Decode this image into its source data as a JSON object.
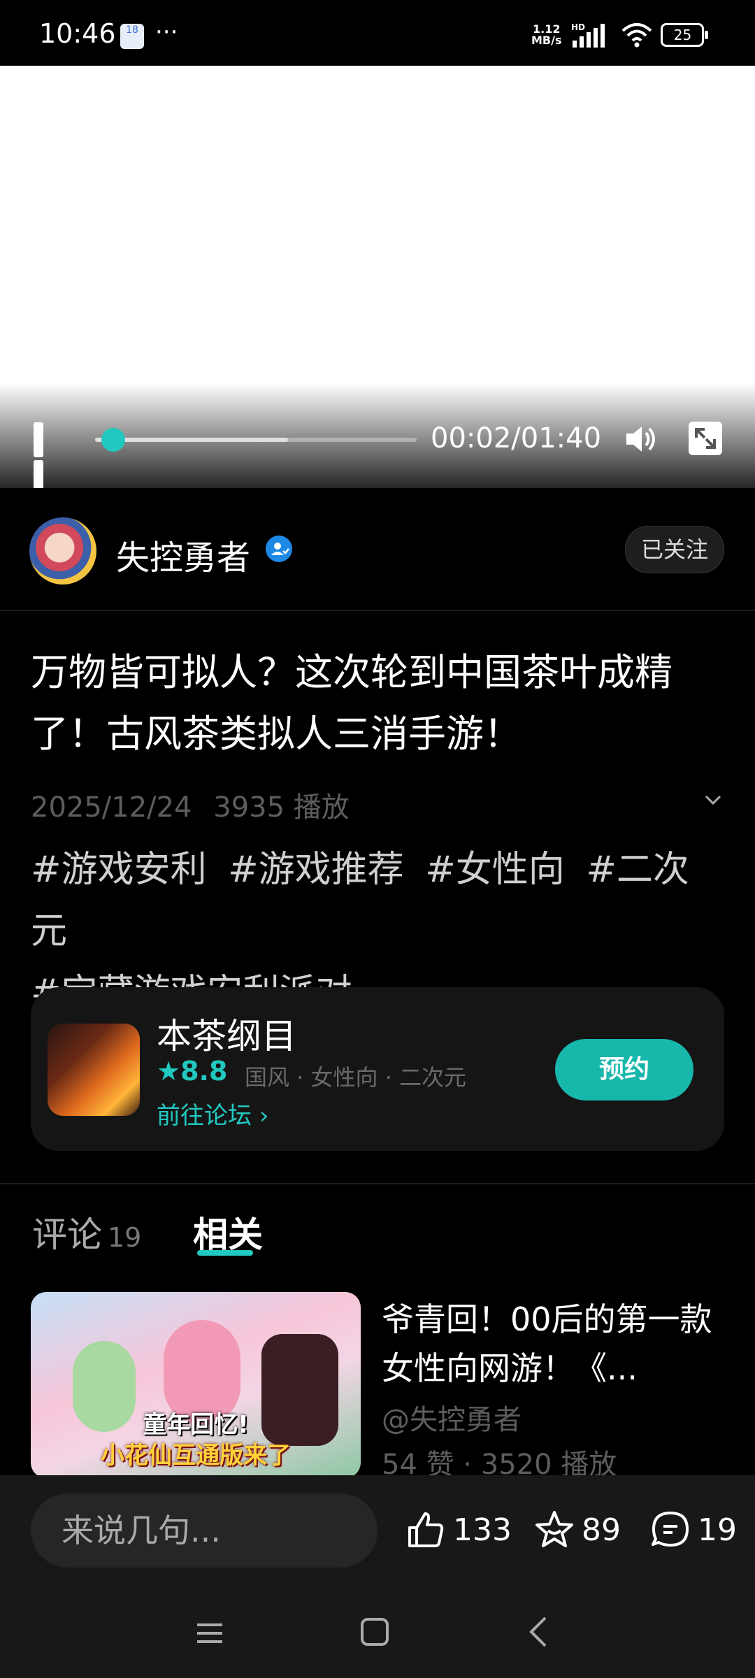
{
  "status_bar": {
    "time": "10:46",
    "notification_badge": "18",
    "more": "···",
    "net_speed_value": "1.12",
    "net_speed_unit": "MB/s",
    "hd": "HD",
    "battery": "25"
  },
  "video": {
    "current_time": "00:02",
    "duration": "01:40",
    "time_display": "00:02/01:40",
    "progress": 0.02,
    "buffered": 0.6
  },
  "author": {
    "name": "失控勇者",
    "follow_label": "已关注"
  },
  "post": {
    "title": "万物皆可拟人？这次轮到中国茶叶成精了！古风茶类拟人三消手游！",
    "date": "2025/12/24",
    "plays": "3935 播放",
    "tags": [
      "#游戏安利",
      "#游戏推荐",
      "#女性向",
      "#二次元",
      "#宝藏游戏安利派对"
    ]
  },
  "game_card": {
    "name": "本茶纲目",
    "rating": "8.8",
    "tags": "国风 · 女性向 · 二次元",
    "forum_link": "前往论坛",
    "reserve_label": "预约"
  },
  "tabs": {
    "comments_label": "评论",
    "comments_count": "19",
    "related_label": "相关"
  },
  "related": [
    {
      "title": "爷青回！00后的第一款女性向网游！《...",
      "author": "@失控勇者",
      "stats": "54 赞 · 3520 播放",
      "thumb_line1": "童年回忆!",
      "thumb_line2": "小花仙互通版来了"
    }
  ],
  "bottom_bar": {
    "comment_placeholder": "来说几句...",
    "likes": "133",
    "favorites": "89",
    "comments": "19"
  },
  "icons": {
    "accent_color": "#21c8c0",
    "reserve_color": "#18b7ac",
    "verified_color": "#1e88e5"
  }
}
